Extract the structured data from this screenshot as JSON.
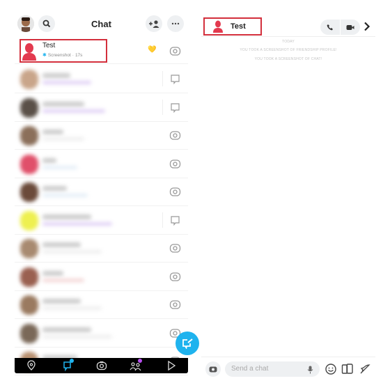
{
  "left_panel": {
    "title": "Chat",
    "header_icons": [
      "bitmoji-avatar",
      "search-icon",
      "add-friend-icon",
      "more-icon"
    ],
    "first_chat": {
      "name": "Test",
      "status_icon": "screenshot-icon",
      "status": "Screenshot",
      "time": "17s",
      "separator": "·",
      "emoji": "💛",
      "action_icon": "camera-icon"
    },
    "rows": [
      {
        "avatar_color": "#c9a58a",
        "action": "chat",
        "name_len": 40,
        "sub_color": "#e0d0f5"
      },
      {
        "avatar_color": "#5a5048",
        "action": "chat",
        "name_len": 60,
        "sub_color": "#e0d0f5"
      },
      {
        "avatar_color": "#8b6f5a",
        "action": "camera",
        "name_len": 30,
        "sub_color": "#eeeeee"
      },
      {
        "avatar_color": "#e0506a",
        "action": "camera",
        "name_len": 20,
        "sub_color": "#e4eef7"
      },
      {
        "avatar_color": "#6b4a3a",
        "action": "camera",
        "name_len": 35,
        "sub_color": "#e4eef7"
      },
      {
        "avatar_color": "#eef050",
        "action": "chat",
        "name_len": 70,
        "sub_color": "#e0d0f5"
      },
      {
        "avatar_color": "#a88a70",
        "action": "camera",
        "name_len": 55,
        "sub_color": "#eeeeee"
      },
      {
        "avatar_color": "#9a6050",
        "action": "camera",
        "name_len": 30,
        "sub_color": "#f3d6d6"
      },
      {
        "avatar_color": "#9a7a60",
        "action": "camera",
        "name_len": 55,
        "sub_color": "#eeeeee"
      },
      {
        "avatar_color": "#7a6858",
        "action": "camera",
        "name_len": 70,
        "sub_color": "#eeeeee"
      },
      {
        "avatar_color": "#b89070",
        "action": "camera",
        "name_len": 50,
        "sub_color": "#eeeeee"
      }
    ],
    "tabs": [
      "map-icon",
      "chat-icon",
      "camera-icon",
      "stories-icon",
      "spotlight-icon"
    ],
    "fab": "new-chat-icon"
  },
  "right_panel": {
    "contact_name": "Test",
    "header_icons": [
      "phone-icon",
      "video-icon",
      "chevron-right-icon"
    ],
    "messages": [
      "TODAY",
      "YOU TOOK A SCREENSHOT OF FRIENDSHIP PROFILE!",
      "YOU TOOK A SCREENSHOT OF CHAT!"
    ],
    "composer": {
      "placeholder": "Send a chat",
      "icons": [
        "camera-icon",
        "mic-icon",
        "emoji-icon",
        "sticker-icon",
        "rocket-icon"
      ]
    }
  },
  "colors": {
    "highlight": "#d32f3c",
    "accent": "#1fb3ee",
    "avatar_red": "#e33a4f"
  }
}
